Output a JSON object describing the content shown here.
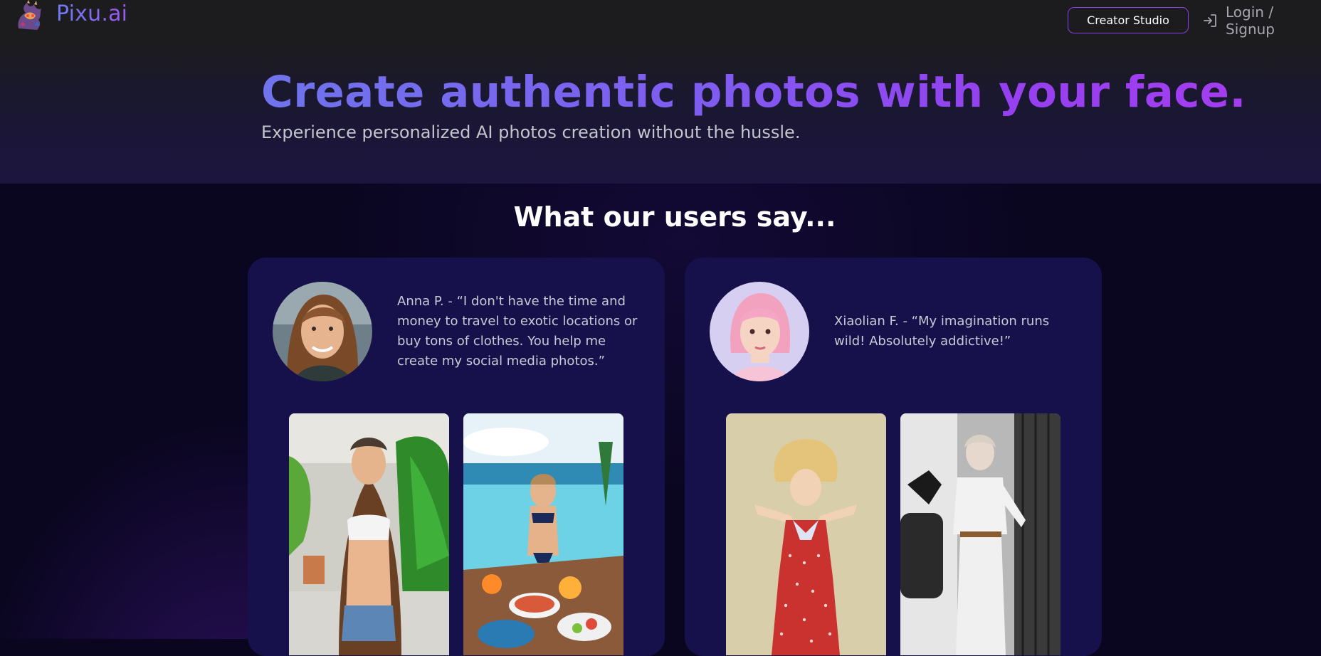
{
  "header": {
    "brand": "Pixu.ai",
    "logo_icon": "dragon-logo-icon",
    "creator_studio_label": "Creator Studio",
    "login_label": "Login / Signup",
    "login_icon": "sign-in-icon"
  },
  "hero": {
    "title": "Create authentic photos with your face.",
    "subtitle": "Experience personalized AI photos creation without the hussle."
  },
  "testimonials": {
    "heading": "What our users say...",
    "items": [
      {
        "quote": "Anna P. - “I don't have the time and money to travel to exotic locations or buy tons of clothes. You help me create my social media photos.”",
        "avatar": "user-avatar-anna",
        "photos": [
          "tropical-selfie-photo",
          "infinity-pool-photo"
        ]
      },
      {
        "quote": "Xiaolian F. - “My imagination runs wild! Absolutely addictive!”",
        "avatar": "user-avatar-xiaolian",
        "photos": [
          "retro-polka-dress-photo",
          "vintage-street-photo"
        ]
      }
    ]
  },
  "colors": {
    "accent_start": "#6f74ec",
    "accent_end": "#a33ef0",
    "card_background": "#16114a",
    "page_background": "#0a0620",
    "topbar_background": "#1c1c1e"
  }
}
